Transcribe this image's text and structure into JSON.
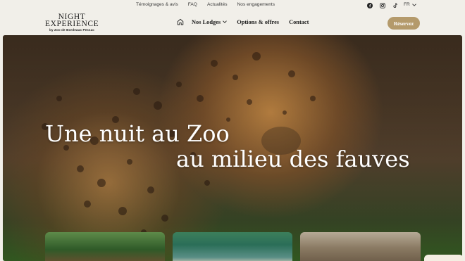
{
  "topbar": {
    "links": [
      "Témoignages & avis",
      "FAQ",
      "Actualités",
      "Nos engagements"
    ],
    "social_icons": [
      "facebook-icon",
      "instagram-icon",
      "tiktok-icon"
    ],
    "language": "FR"
  },
  "logo": {
    "line1": "NIGHT",
    "line2": "EXPERIENCE",
    "line3": "by Zoo de Bordeaux Pessac"
  },
  "nav": {
    "home_icon": "home-icon",
    "items": [
      {
        "label": "Nos Lodges",
        "has_dropdown": true
      },
      {
        "label": "Options & offres",
        "has_dropdown": false
      },
      {
        "label": "Contact",
        "has_dropdown": false
      }
    ],
    "cta_label": "Réservez"
  },
  "hero": {
    "headline_line1": "Une nuit au Zoo",
    "headline_line2": "au milieu des fauves"
  },
  "colors": {
    "accent": "#b49a6b",
    "background": "#f1efe9",
    "text": "#1d1d1d"
  }
}
